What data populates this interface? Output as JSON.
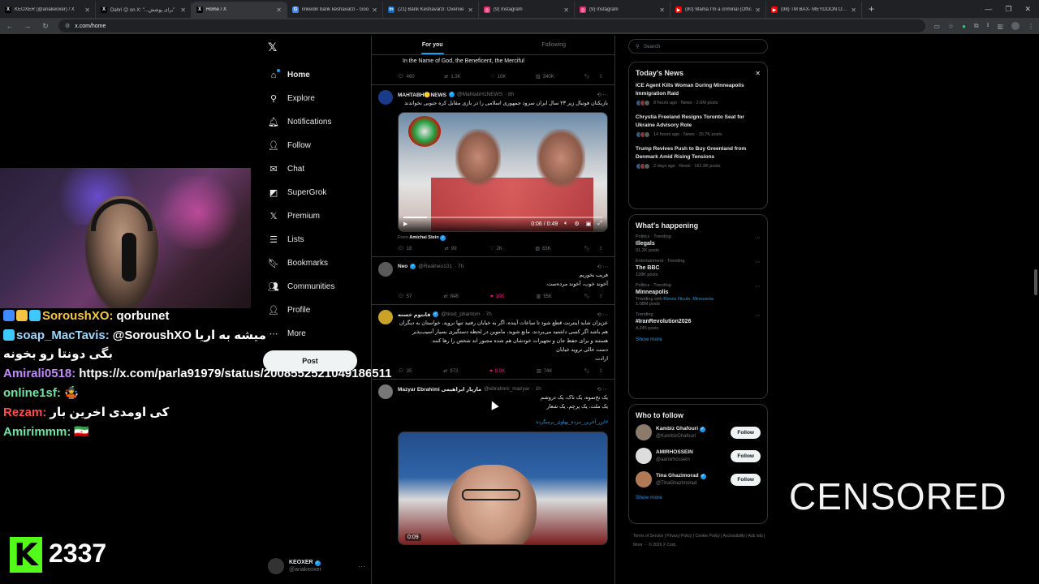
{
  "browser": {
    "tabs": [
      {
        "label": "KEOXER (@ariakeoxer) / X",
        "fav": "X",
        "color": "#000000"
      },
      {
        "label": "Dahri 😊 on X: \"...برای پوشش\"",
        "fav": "X",
        "color": "#000000"
      },
      {
        "label": "Home / X",
        "fav": "X",
        "color": "#000000",
        "active": true
      },
      {
        "label": "linkedin bank keshavarzi - Goo",
        "fav": "G",
        "color": "#4285f4"
      },
      {
        "label": "(21) Bank Keshavarzi: Overvie",
        "fav": "in",
        "color": "#0a66c2"
      },
      {
        "label": "(9) Instagram",
        "fav": "◎",
        "color": "#e1306c"
      },
      {
        "label": "(9) Instagram",
        "fav": "◎",
        "color": "#e1306c"
      },
      {
        "label": "(80) Mama I'm a criminal (Offic",
        "fav": "▶",
        "color": "#ff0000"
      },
      {
        "label": "(98) TM BAX- MEYDOON OFFIC",
        "fav": "▶",
        "color": "#ff0000"
      }
    ],
    "new_tab": "+",
    "url": "x.com/home"
  },
  "stream": {
    "chat": [
      {
        "user": "SoroushXO:",
        "user_color": "#f5c542",
        "text": "qorbunet",
        "badges": [
          "#3d8bff",
          "#f5c542",
          "#3dc9ff"
        ]
      },
      {
        "user": "soap_MacTavis:",
        "user_color": "#9ad7ff",
        "text": "@SoroushXO میشه به اریا بگی دونتا رو بخونه",
        "badges": [
          "#3dc9ff"
        ]
      },
      {
        "user": "Amirali0518:",
        "user_color": "#c38bff",
        "text": "https://x.com/parla91979/status/2008552521049186511",
        "badges": []
      },
      {
        "user": "online1sf:",
        "user_color": "#6fe3a4",
        "text": "🤹",
        "badges": []
      },
      {
        "user": "Rezam:",
        "user_color": "#ff4d4d",
        "text": "کی اومدی اخرین بار",
        "badges": []
      },
      {
        "user": "Amirimmm:",
        "user_color": "#6fe3a4",
        "text": "🇮🇷",
        "badges": []
      }
    ],
    "kick_logo": "K",
    "viewer_count": "2337",
    "censored": "CENSORED"
  },
  "xnav": {
    "logo": "𝕏",
    "items": [
      {
        "label": "Home",
        "icon": "⌂",
        "icon_name": "home-icon",
        "active": true
      },
      {
        "label": "Explore",
        "icon": "⚲",
        "icon_name": "search-icon"
      },
      {
        "label": "Notifications",
        "icon": "🔔︎",
        "icon_name": "bell-icon"
      },
      {
        "label": "Follow",
        "icon": "👤︎",
        "icon_name": "follow-icon"
      },
      {
        "label": "Chat",
        "icon": "✉",
        "icon_name": "chat-icon"
      },
      {
        "label": "SuperGrok",
        "icon": "◩",
        "icon_name": "grok-icon"
      },
      {
        "label": "Premium",
        "icon": "𝕏",
        "icon_name": "premium-icon"
      },
      {
        "label": "Lists",
        "icon": "☰",
        "icon_name": "lists-icon"
      },
      {
        "label": "Bookmarks",
        "icon": "🔖︎",
        "icon_name": "bookmark-icon"
      },
      {
        "label": "Communities",
        "icon": "👥︎",
        "icon_name": "communities-icon"
      },
      {
        "label": "Profile",
        "icon": "👤︎",
        "icon_name": "profile-icon"
      },
      {
        "label": "More",
        "icon": "⋯",
        "icon_name": "more-icon"
      }
    ],
    "post_label": "Post",
    "account": {
      "name": "KEOXER",
      "handle": "@ariakeoxer",
      "more": "···"
    }
  },
  "feed": {
    "tabs": [
      "For you",
      "Following"
    ],
    "tweets": [
      {
        "partial": true,
        "body": "In the Name of God, the Beneficent, the Merciful",
        "stats": {
          "replies": "460",
          "retweets": "1.3K",
          "likes": "10K",
          "views": "340K"
        }
      },
      {
        "name": "MAHTABH🟡NEWS",
        "handle": "@MahtabH1NEWS",
        "time": "· 8h",
        "avatar_color": "#1a3a8a",
        "body": "بازیکنان فوتبال زیر ۲۳ سال ایران سرود جمهوری اسلامی را در بازی مقابل کره جنوبی نخواندند",
        "video_time": "0:06 / 0:49",
        "from_label": "From",
        "from_name": "Amichai Stein",
        "stats": {
          "replies": "18",
          "retweets": "99",
          "likes": "2K",
          "views": "63K"
        }
      },
      {
        "name": "Neo",
        "handle": "@Realneo101",
        "time": "· 7h",
        "avatar_color": "#5a5a5a",
        "body_lines": [
          "فریب نخوریم",
          "آخوند خوب، آخوند مرده‌ست."
        ],
        "stats": {
          "replies": "57",
          "retweets": "848",
          "likes": "10K",
          "views": "55K"
        }
      },
      {
        "name": "فانتوم خسته",
        "handle": "@tired_phantom",
        "time": "· 7h",
        "avatar_color": "#c9a227",
        "body_lines": [
          "عزیزان شاید اینترنت قطع شود تا ساعات آینده، اگر به خیابان رفتید تنها نروید، خواستان به دیگران هم باشد اگر کسی داشتید می‌بردند، مانع شوید، ماموین در لحظه دستگیری بسیار آسیب‌پذیر هستند و برای حفظ جان و تجهیزات خودشان هم شده مجبور اند شخص را رها کنند.",
          "دست خالی نروید خیابان",
          "ارادت"
        ],
        "stats": {
          "replies": "35",
          "retweets": "972",
          "likes": "8.9K",
          "views": "74K"
        }
      },
      {
        "name": "Mazyar Ebrahimi مازیار ابراهیمی",
        "handle": "@ebrahimi_mazyar",
        "time": "· 1h",
        "avatar_color": "#777777",
        "body_lines": [
          "یک نخ‌نموه، یک تاک، یک دروشم",
          "یک ملت، یک پرچم، یک شعار"
        ],
        "hashtag": "#این_آخرین_نبرده_پهلوی_برمیگرده",
        "video_time": "0:09"
      }
    ]
  },
  "right": {
    "search_placeholder": "Search",
    "news": {
      "title": "Today's News",
      "close": "✕",
      "items": [
        {
          "title": "ICE Agent Kills Woman During Minneapolis Immigration Raid",
          "meta": "8 hours ago · News · 2.6M posts"
        },
        {
          "title": "Chrystia Freeland Resigns Toronto Seat for Ukraine Advisory Role",
          "meta": "14 hours ago · News · 15.7K posts"
        },
        {
          "title": "Trump Revives Push to Buy Greenland from Denmark Amid Rising Tensions",
          "meta": "2 days ago · News · 161.9K posts"
        }
      ]
    },
    "happening": {
      "title": "What's happening",
      "items": [
        {
          "cat": "Politics · Trending",
          "name": "Illegals",
          "count": "91.2K posts"
        },
        {
          "cat": "Entertainment · Trending",
          "name": "The BBC",
          "count": "128K posts"
        },
        {
          "cat": "Politics · Trending",
          "name": "Minneapolis",
          "sub_prefix": "Trending with",
          "sub_links": "Renee Nicole, Minnesota",
          "count": "1.08M posts"
        },
        {
          "cat": "Trending",
          "name": "#IranRevolution2026",
          "count": "4,245 posts"
        }
      ],
      "show_more": "Show more"
    },
    "who_to_follow": {
      "title": "Who to follow",
      "items": [
        {
          "name": "Kambiz Ghafouri",
          "handle": "@KambizGhafouri",
          "verified": true,
          "avatar_color": "#8c7a6b"
        },
        {
          "name": "AMIRHOSSEIN",
          "handle": "@aamirhossein",
          "verified": false,
          "avatar_color": "#dddddd"
        },
        {
          "name": "Tina Ghazimorad",
          "handle": "@TinaGhazimorad",
          "verified": true,
          "avatar_color": "#b07a55"
        }
      ],
      "follow_label": "Follow",
      "show_more": "Show more"
    },
    "footer": "Terms of Service | Privacy Policy | Cookie Policy | Accessibility | Ads info | More ··· © 2026 X Corp."
  }
}
